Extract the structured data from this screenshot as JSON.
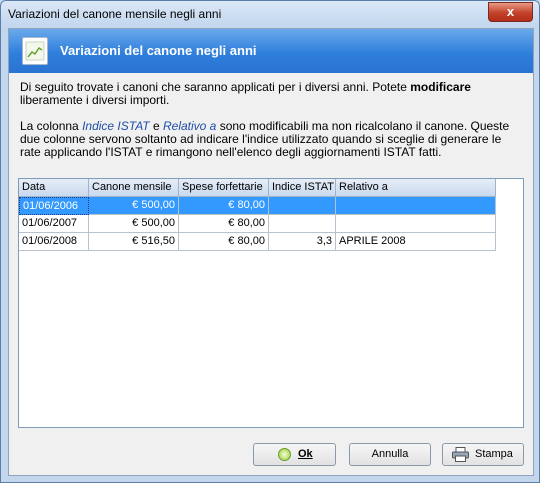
{
  "window": {
    "title": "Variazioni del canone mensile negli anni",
    "close_glyph": "x"
  },
  "header": {
    "title": "Variazioni del canone negli anni",
    "icon": "chart-icon"
  },
  "intro": {
    "line1_pre": "Di seguito trovate i canoni che saranno applicati per i diversi anni. Potete ",
    "line1_bold": "modificare",
    "line1_post": " liberamente i diversi importi.",
    "note_pre": "La colonna ",
    "note_col1": "Indice ISTAT",
    "note_mid": " e ",
    "note_col2": "Relativo a",
    "note_post": " sono modificabili ma non ricalcolano il canone. Queste due colonne servono soltanto ad indicare l'indice utilizzato quando si sceglie di generare le rate applicando l'ISTAT e rimangono nell'elenco degli aggiornamenti ISTAT fatti."
  },
  "table": {
    "columns": [
      "Data",
      "Canone mensile",
      "Spese forfettarie",
      "Indice ISTAT",
      "Relativo a"
    ],
    "rows": [
      [
        "01/06/2006",
        "€ 500,00",
        "€ 80,00",
        "",
        ""
      ],
      [
        "01/06/2007",
        "€ 500,00",
        "€ 80,00",
        "",
        ""
      ],
      [
        "01/06/2008",
        "€ 516,50",
        "€ 80,00",
        "3,3",
        "APRILE 2008"
      ]
    ],
    "selected_row": 0
  },
  "buttons": {
    "ok": "Ok",
    "cancel": "Annulla",
    "print": "Stampa"
  },
  "colors": {
    "header": "#2f7fdd",
    "selection": "#3399ff",
    "close": "#c2412a"
  }
}
